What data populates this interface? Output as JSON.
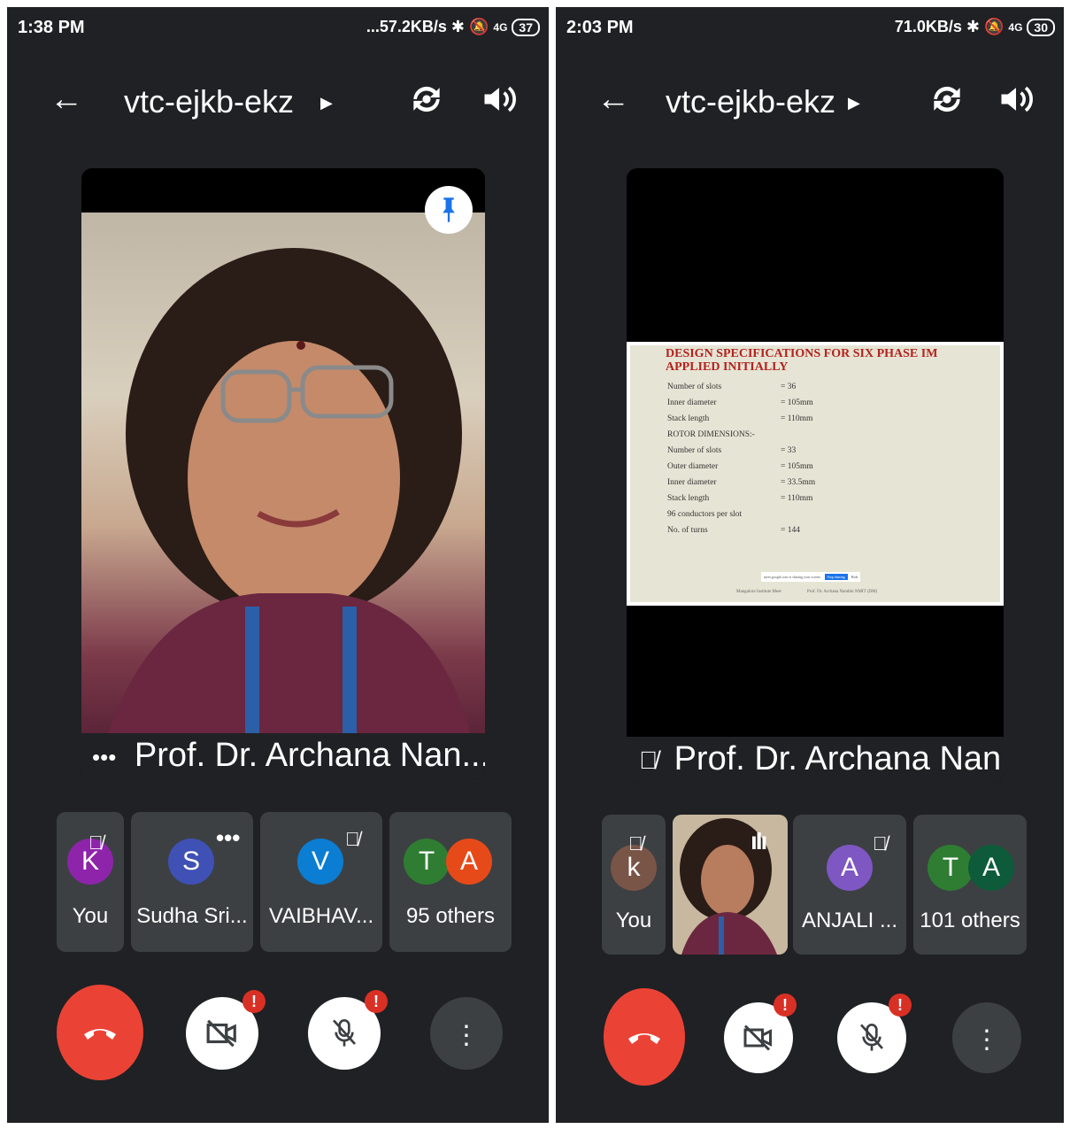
{
  "left": {
    "status": {
      "time": "1:38 PM",
      "speed": "...57.2KB/s",
      "network": "4G",
      "battery": "37"
    },
    "header": {
      "meeting_code": "vtc-ejkb-ekz"
    },
    "speaker": {
      "name_prefix": "•••",
      "name": "Prof. Dr. Archana Nan..."
    },
    "participants": [
      {
        "initial": "K",
        "label": "You",
        "color": "#8e24aa"
      },
      {
        "initial": "S",
        "label": "Sudha Sri...",
        "color": "#3f51b5"
      },
      {
        "initial": "V",
        "label": "VAIBHAV...",
        "color": "#0b7dd2"
      },
      {
        "initial_a": "T",
        "initial_b": "A",
        "label": "95 others",
        "color_a": "#2e7d32",
        "color_b": "#e64a19"
      }
    ]
  },
  "right": {
    "status": {
      "time": "2:03 PM",
      "speed": "71.0KB/s",
      "network": "4G",
      "battery": "30"
    },
    "header": {
      "meeting_code": "vtc-ejkb-ekz"
    },
    "speaker": {
      "name": "Prof. Dr. Archana Nan..."
    },
    "slide": {
      "title": "DESIGN SPECIFICATIONS FOR SIX PHASE IM APPLIED INITIALLY",
      "rows": [
        {
          "label": "Number of slots",
          "value": "= 36"
        },
        {
          "label": "Inner diameter",
          "value": "= 105mm"
        },
        {
          "label": "Stack length",
          "value": "= 110mm"
        },
        {
          "label": "ROTOR DIMENSIONS:-",
          "value": ""
        },
        {
          "label": "Number of slots",
          "value": "= 33"
        },
        {
          "label": "Outer diameter",
          "value": "= 105mm"
        },
        {
          "label": "Inner diameter",
          "value": "= 33.5mm"
        },
        {
          "label": "Stack length",
          "value": "= 110mm"
        },
        {
          "label": "96 conductors per slot",
          "value": ""
        },
        {
          "label": "No. of turns",
          "value": "= 144"
        }
      ],
      "share_notice": "meet.google.com is sharing your screen.",
      "stop_sharing": "Stop sharing",
      "hide": "Hide",
      "footer_center": "Mangalore Institute Meet",
      "footer_right": "Prof. Dr. Archana Nandini NMIT (DM)"
    },
    "participants": [
      {
        "initial": "k",
        "label": "You",
        "color": "#795548"
      },
      {
        "label": ""
      },
      {
        "initial": "A",
        "label": "ANJALI ...",
        "color": "#7e57c2"
      },
      {
        "initial_a": "T",
        "initial_b": "A",
        "label": "101 others",
        "color_a": "#2e7d32",
        "color_b": "#0d5b3a"
      }
    ]
  },
  "icons": [
    "back-arrow-icon",
    "camera-switch-icon",
    "speaker-icon",
    "pin-icon",
    "mic-off-icon",
    "more-dots-icon",
    "hang-up-icon",
    "camera-off-icon",
    "audio-wave-icon",
    "alert-icon",
    "bluetooth-icon",
    "signal-icon"
  ],
  "colors": {
    "background": "#202124",
    "tile": "#3c4043",
    "hangup": "#ea4335",
    "alert": "#d93025",
    "pin": "#1a73e8"
  }
}
